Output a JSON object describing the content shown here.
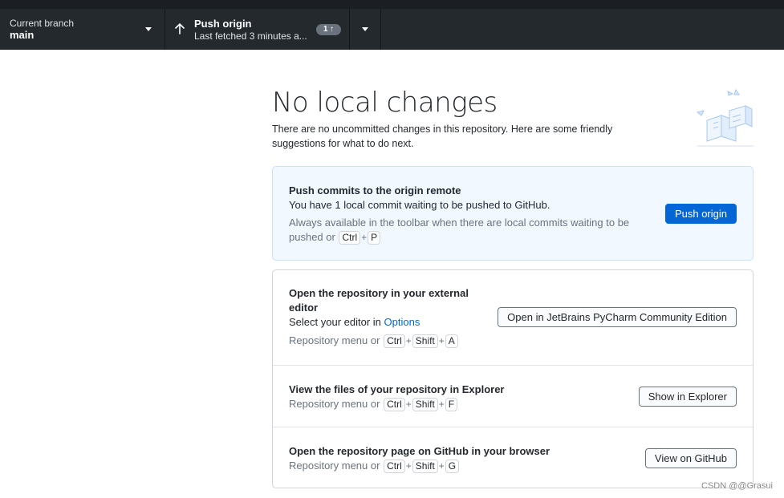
{
  "toolbar": {
    "branch": {
      "label": "Current branch",
      "value": "main"
    },
    "push": {
      "label": "Push origin",
      "sublabel": "Last fetched 3 minutes a...",
      "badge": "1 ↑"
    }
  },
  "main": {
    "heading": "No local changes",
    "subtext": "There are no uncommitted changes in this repository. Here are some friendly suggestions for what to do next."
  },
  "suggestions": {
    "push": {
      "title": "Push commits to the origin remote",
      "desc": "You have 1 local commit waiting to be pushed to GitHub.",
      "hint": "Always available in the toolbar when there are local commits waiting to be pushed or",
      "keys": [
        "Ctrl",
        "P"
      ],
      "button": "Push origin"
    },
    "editor": {
      "title": "Open the repository in your external editor",
      "desc": "Select your editor in",
      "link": "Options",
      "hint": "Repository menu or",
      "keys": [
        "Ctrl",
        "Shift",
        "A"
      ],
      "button": "Open in JetBrains PyCharm Community Edition"
    },
    "explorer": {
      "title": "View the files of your repository in Explorer",
      "hint": "Repository menu or",
      "keys": [
        "Ctrl",
        "Shift",
        "F"
      ],
      "button": "Show in Explorer"
    },
    "github": {
      "title": "Open the repository page on GitHub in your browser",
      "hint": "Repository menu or",
      "keys": [
        "Ctrl",
        "Shift",
        "G"
      ],
      "button": "View on GitHub"
    }
  },
  "watermark": "CSDN @@Grasui",
  "colors": {
    "toolbar": "#24292e",
    "accent": "#0366d6",
    "card_blue": "#f1f8ff"
  }
}
